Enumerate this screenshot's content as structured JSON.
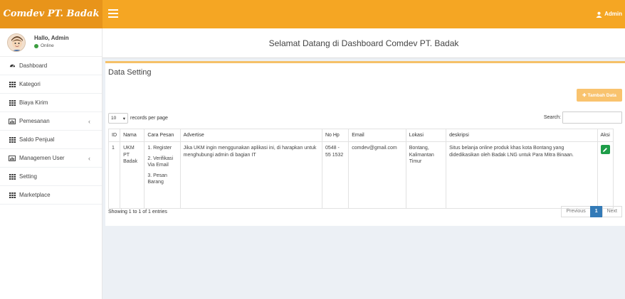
{
  "app": {
    "logo_text": "Comdev PT. Badak"
  },
  "topbar": {
    "user_label": "Admin"
  },
  "sidebar": {
    "greeting": "Hallo, Admin",
    "status": "Online",
    "items": [
      {
        "label": "Dashboard",
        "icon": "dashboard-icon"
      },
      {
        "label": "Kategori",
        "icon": "table-icon"
      },
      {
        "label": "Biaya Kirim",
        "icon": "table-icon"
      },
      {
        "label": "Pemesanan",
        "icon": "chart-icon",
        "has_chevron": true
      },
      {
        "label": "Saldo Penjual",
        "icon": "table-icon"
      },
      {
        "label": "Managemen User",
        "icon": "chart-icon",
        "has_chevron": true
      },
      {
        "label": "Setting",
        "icon": "table-icon"
      },
      {
        "label": "Marketplace",
        "icon": "table-icon"
      }
    ]
  },
  "page": {
    "title": "Selamat Datang di Dashboard Comdev PT. Badak"
  },
  "box": {
    "title": "Data Setting",
    "add_button": "Tambah Data",
    "length_value": "10",
    "length_suffix": "records per page",
    "search_label": "Search:",
    "search_value": ""
  },
  "table": {
    "columns": [
      "ID",
      "Nama",
      "Cara Pesan",
      "Advertise",
      "No Hp",
      "Email",
      "Lokasi",
      "deskripsi",
      "Aksi"
    ],
    "rows": [
      {
        "id": "1",
        "nama": "UKM PT Badak",
        "cara_pesan": [
          "1. Register",
          "2. Verifikasi Via Email",
          "3. Pesan Barang"
        ],
        "advertise": "Jika UKM ingin menggunakan aplikasi ini, di harapkan untuk menghubungi admin di bagian IT",
        "no_hp": "0548 - 55 1532",
        "email": "comdev@gmail.com",
        "lokasi": "Bontang, Kalimantan Timur",
        "deskripsi": "Situs belanja online produk khas kota Bontang yang didedikasikan oleh Badak LNG untuk Para Mitra Binaan."
      }
    ]
  },
  "footer": {
    "info": "Showing 1 to 1 of 1 entries",
    "previous": "Previous",
    "current_page": "1",
    "next": "Next"
  },
  "colors": {
    "topbar": "#f5a623",
    "logo_bg": "#e8941a",
    "edit_button": "#1e9d49",
    "page_active": "#337ab7"
  }
}
